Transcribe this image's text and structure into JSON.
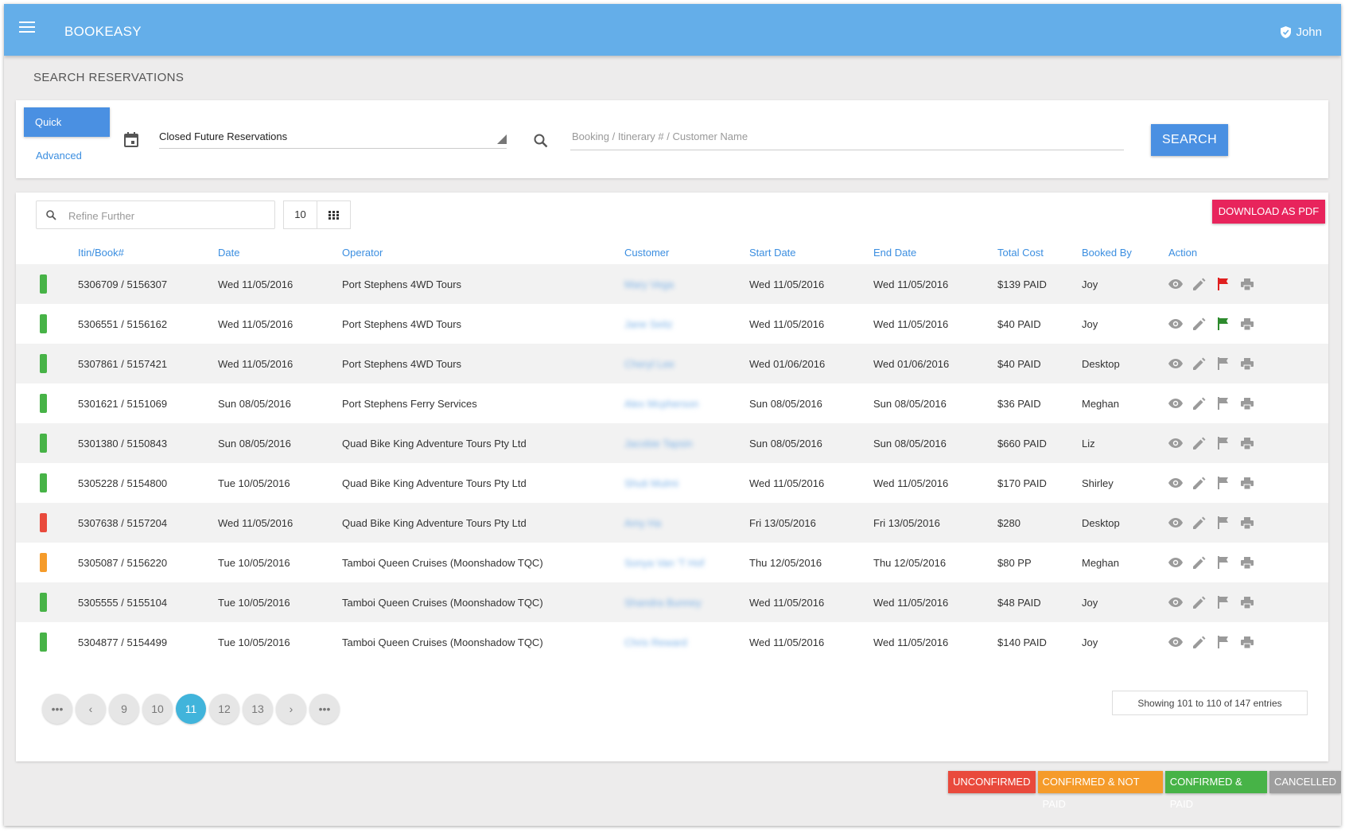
{
  "header": {
    "brand": "BOOKEASY",
    "user": "John"
  },
  "page_title": "SEARCH RESERVATIONS",
  "search": {
    "quick_label": "Quick",
    "advanced_label": "Advanced",
    "filter_value": "Closed Future Reservations",
    "placeholder": "Booking / Itinerary # / Customer Name",
    "button_label": "SEARCH"
  },
  "results": {
    "refine_placeholder": "Refine Further",
    "page_size": "10",
    "pdf_label": "DOWNLOAD AS PDF",
    "columns": [
      "Itin/Book#",
      "Date",
      "Operator",
      "Customer",
      "Start Date",
      "End Date",
      "Total Cost",
      "Booked By",
      "Action"
    ],
    "rows": [
      {
        "status": "#47b347",
        "itin": "5306709 / 5156307",
        "date": "Wed 11/05/2016",
        "operator": "Port Stephens 4WD Tours",
        "customer": "Mary Vega",
        "start": "Wed 11/05/2016",
        "end": "Wed 11/05/2016",
        "cost": "$139 PAID",
        "booked_by": "Joy",
        "flag": "#e02020"
      },
      {
        "status": "#47b347",
        "itin": "5306551 / 5156162",
        "date": "Wed 11/05/2016",
        "operator": "Port Stephens 4WD Tours",
        "customer": "Jane Seitz",
        "start": "Wed 11/05/2016",
        "end": "Wed 11/05/2016",
        "cost": "$40 PAID",
        "booked_by": "Joy",
        "flag": "#2e8b2e"
      },
      {
        "status": "#47b347",
        "itin": "5307861 / 5157421",
        "date": "Wed 11/05/2016",
        "operator": "Port Stephens 4WD Tours",
        "customer": "Cheryl Lee",
        "start": "Wed 01/06/2016",
        "end": "Wed 01/06/2016",
        "cost": "$40 PAID",
        "booked_by": "Desktop",
        "flag": "#9a9a9a"
      },
      {
        "status": "#47b347",
        "itin": "5301621 / 5151069",
        "date": "Sun 08/05/2016",
        "operator": "Port Stephens Ferry Services",
        "customer": "Alex Mcpherson",
        "start": "Sun 08/05/2016",
        "end": "Sun 08/05/2016",
        "cost": "$36 PAID",
        "booked_by": "Meghan",
        "flag": "#9a9a9a"
      },
      {
        "status": "#47b347",
        "itin": "5301380 / 5150843",
        "date": "Sun 08/05/2016",
        "operator": "Quad Bike King Adventure Tours Pty Ltd",
        "customer": "Jacobie Tapsin",
        "start": "Sun 08/05/2016",
        "end": "Sun 08/05/2016",
        "cost": "$660 PAID",
        "booked_by": "Liz",
        "flag": "#9a9a9a"
      },
      {
        "status": "#47b347",
        "itin": "5305228 / 5154800",
        "date": "Tue 10/05/2016",
        "operator": "Quad Bike King Adventure Tours Pty Ltd",
        "customer": "Shuti Mulmi",
        "start": "Wed 11/05/2016",
        "end": "Wed 11/05/2016",
        "cost": "$170 PAID",
        "booked_by": "Shirley",
        "flag": "#9a9a9a"
      },
      {
        "status": "#e94a3c",
        "itin": "5307638 / 5157204",
        "date": "Wed 11/05/2016",
        "operator": "Quad Bike King Adventure Tours Pty Ltd",
        "customer": "Amy Ha",
        "start": "Fri 13/05/2016",
        "end": "Fri 13/05/2016",
        "cost": "$280",
        "booked_by": "Desktop",
        "flag": "#9a9a9a"
      },
      {
        "status": "#f59b2a",
        "itin": "5305087 / 5156220",
        "date": "Tue 10/05/2016",
        "operator": "Tamboi Queen Cruises (Moonshadow TQC)",
        "customer": "Sonya Van 'T Hof",
        "start": "Thu 12/05/2016",
        "end": "Thu 12/05/2016",
        "cost": "$80 PP",
        "booked_by": "Meghan",
        "flag": "#9a9a9a"
      },
      {
        "status": "#47b347",
        "itin": "5305555 / 5155104",
        "date": "Tue 10/05/2016",
        "operator": "Tamboi Queen Cruises (Moonshadow TQC)",
        "customer": "Shandra Bunney",
        "start": "Wed 11/05/2016",
        "end": "Wed 11/05/2016",
        "cost": "$48 PAID",
        "booked_by": "Joy",
        "flag": "#9a9a9a"
      },
      {
        "status": "#47b347",
        "itin": "5304877 / 5154499",
        "date": "Tue 10/05/2016",
        "operator": "Tamboi Queen Cruises (Moonshadow TQC)",
        "customer": "Chris Reward",
        "start": "Wed 11/05/2016",
        "end": "Wed 11/05/2016",
        "cost": "$140 PAID",
        "booked_by": "Joy",
        "flag": "#9a9a9a"
      }
    ],
    "pagination": [
      "...",
      "<",
      "9",
      "10",
      "11",
      "12",
      "13",
      ">",
      "..."
    ],
    "current_page": "11",
    "showing": "Showing 101 to 110 of 147 entries"
  },
  "legend": [
    {
      "label": "UNCONFIRMED",
      "color": "#e94a3c"
    },
    {
      "label": "CONFIRMED & NOT PAID",
      "color": "#f59b2a"
    },
    {
      "label": "CONFIRMED & PAID",
      "color": "#47b347"
    },
    {
      "label": "CANCELLED",
      "color": "#9e9e9e"
    }
  ]
}
